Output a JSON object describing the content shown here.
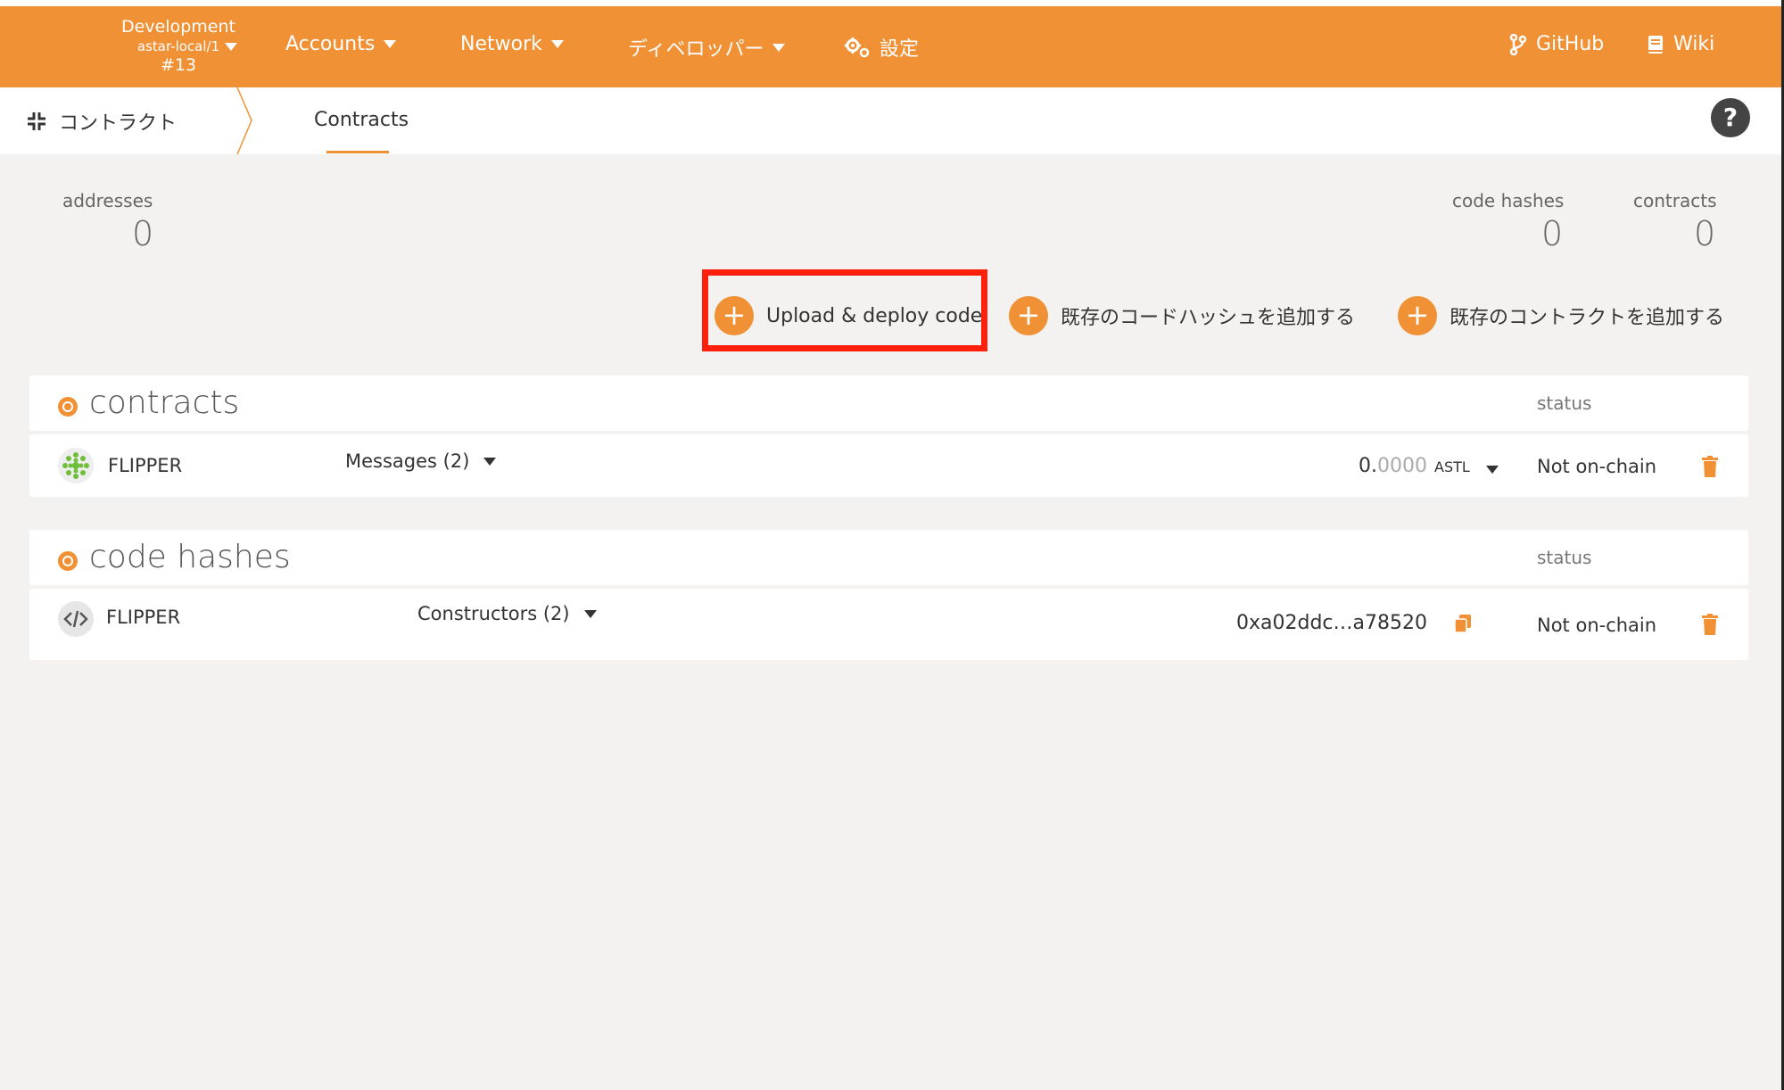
{
  "topbar": {
    "chain_label": "Development",
    "chain_name": "astar-local/1",
    "block_number": "#13",
    "nav": [
      {
        "label": "Accounts"
      },
      {
        "label": "Network"
      },
      {
        "label": "ディベロッパー"
      },
      {
        "label": "設定"
      }
    ],
    "github_label": "GitHub",
    "wiki_label": "Wiki"
  },
  "subbar": {
    "section_label": "コントラクト",
    "active_tab": "Contracts",
    "help_symbol": "?"
  },
  "summary": {
    "addresses_label": "addresses",
    "addresses_value": "0",
    "code_hashes_label": "code hashes",
    "code_hashes_value": "0",
    "contracts_label": "contracts",
    "contracts_value": "0"
  },
  "actions": {
    "upload_label": "Upload & deploy code",
    "add_hash_label": "既存のコードハッシュを追加する",
    "add_contract_label": "既存のコントラクトを追加する"
  },
  "contracts_panel": {
    "title": "contracts",
    "status_header": "status",
    "rows": [
      {
        "name": "FLIPPER",
        "messages_label": "Messages (2)",
        "balance_int": "0.",
        "balance_dec": "0000",
        "balance_unit": "ASTL",
        "status": "Not on-chain"
      }
    ]
  },
  "code_hashes_panel": {
    "title": "code hashes",
    "status_header": "status",
    "rows": [
      {
        "name": "FLIPPER",
        "constructors_label": "Constructors (2)",
        "hash": "0xa02ddc…a78520",
        "status": "Not on-chain"
      }
    ]
  },
  "colors": {
    "accent": "#f19135",
    "highlight": "#ff1f0d",
    "background": "#f4f2f0"
  },
  "icons": [
    "caret-down-icon",
    "gear-icon",
    "branch-icon",
    "book-icon",
    "collapse-icon",
    "help-icon",
    "plus-icon",
    "flipper-identicon",
    "code-icon",
    "copy-icon",
    "trash-icon"
  ]
}
